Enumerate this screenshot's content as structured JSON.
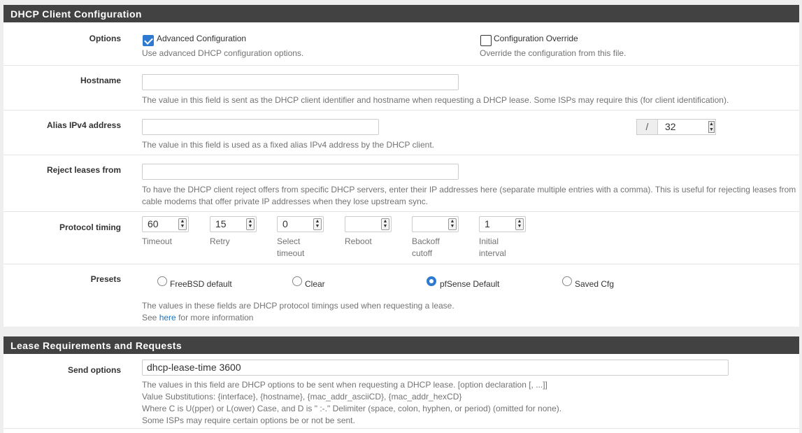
{
  "dhcp_panel": {
    "title": "DHCP Client Configuration",
    "options": {
      "label": "Options",
      "advanced": {
        "label": "Advanced Configuration",
        "checked": true,
        "help": "Use advanced DHCP configuration options."
      },
      "override": {
        "label": "Configuration Override",
        "checked": false,
        "help": "Override the configuration from this file."
      }
    },
    "hostname": {
      "label": "Hostname",
      "value": "",
      "help": "The value in this field is sent as the DHCP client identifier and hostname when requesting a DHCP lease. Some ISPs may require this (for client identification)."
    },
    "alias": {
      "label": "Alias IPv4 address",
      "value": "",
      "slash": "/",
      "subnet": "32",
      "help": "The value in this field is used as a fixed alias IPv4 address by the DHCP client."
    },
    "reject": {
      "label": "Reject leases from",
      "value": "",
      "help_line1": "To have the DHCP client reject offers from specific DHCP servers, enter their IP addresses here (separate multiple entries with a comma). This is useful for rejecting leases from",
      "help_line2": "cable modems that offer private IP addresses when they lose upstream sync."
    },
    "timing": {
      "label": "Protocol timing",
      "fields": [
        {
          "value": "60",
          "label1": "Timeout",
          "label2": ""
        },
        {
          "value": "15",
          "label1": "Retry",
          "label2": ""
        },
        {
          "value": "0",
          "label1": "Select",
          "label2": "timeout"
        },
        {
          "value": "",
          "label1": "Reboot",
          "label2": ""
        },
        {
          "value": "",
          "label1": "Backoff",
          "label2": "cutoff"
        },
        {
          "value": "1",
          "label1": "Initial",
          "label2": "interval"
        }
      ]
    },
    "presets": {
      "label": "Presets",
      "options": [
        {
          "label": "FreeBSD default",
          "selected": false
        },
        {
          "label": "Clear",
          "selected": false
        },
        {
          "label": "pfSense Default",
          "selected": true
        },
        {
          "label": "Saved Cfg",
          "selected": false
        }
      ],
      "help_line1": "The values in these fields are DHCP protocol timings used when requesting a lease.",
      "help_see": "See",
      "help_link": "here",
      "help_rest": "for more information"
    }
  },
  "lease_panel": {
    "title": "Lease Requirements and Requests",
    "send_options": {
      "label": "Send options",
      "value": "dhcp-lease-time 3600",
      "help_lines": [
        "The values in this field are DHCP options to be sent when requesting a DHCP lease. [option declaration [, ...]]",
        "Value Substitutions: {interface}, {hostname}, {mac_addr_asciiCD}, {mac_addr_hexCD}",
        "Where C is U(pper) or L(ower) Case, and D is \" :-.\" Delimiter (space, colon, hyphen, or period) (omitted for none).",
        "Some ISPs may require certain options be or not be sent."
      ]
    }
  }
}
